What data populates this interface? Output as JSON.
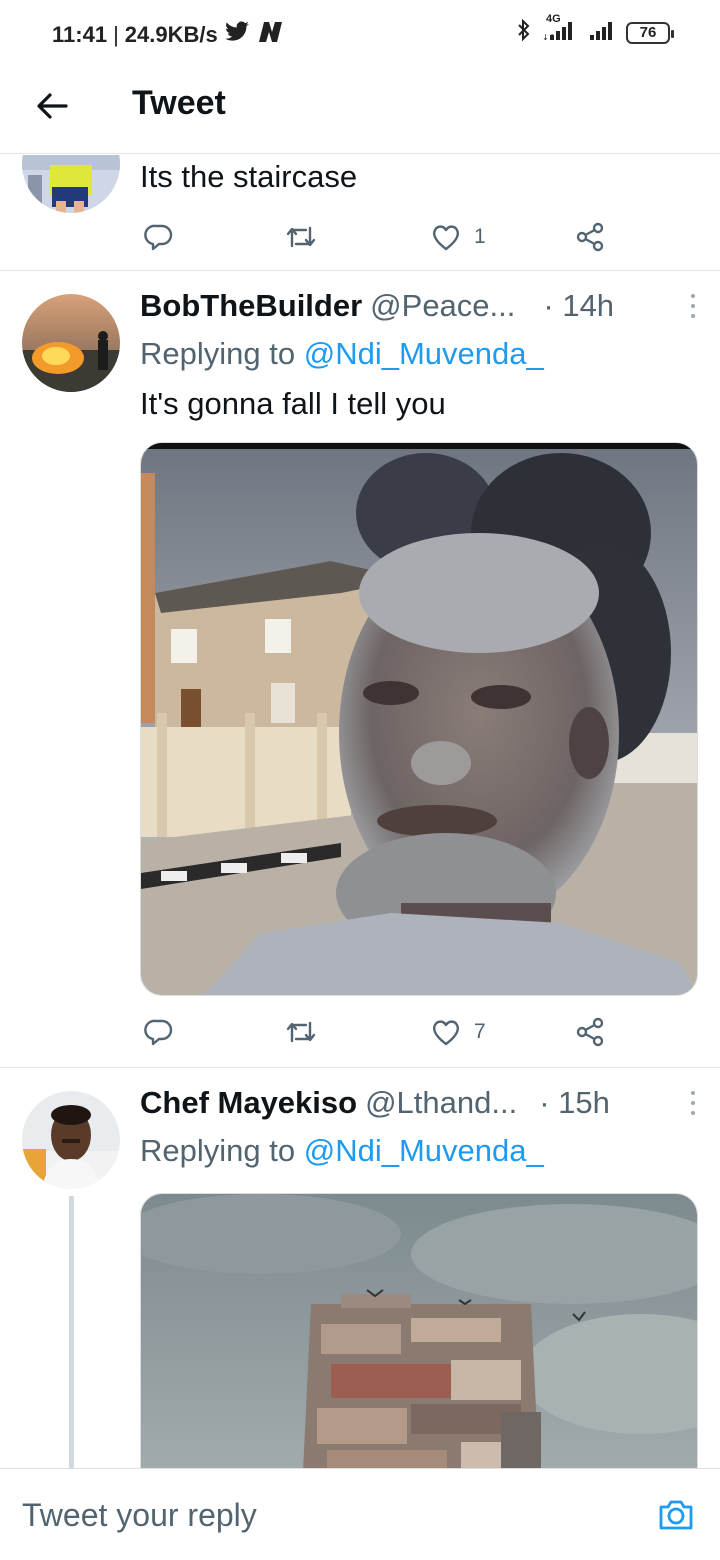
{
  "status_bar": {
    "time": "11:41",
    "speed": "24.9KB/s",
    "network": "4G",
    "battery": "76",
    "icons": [
      "twitter-bird-icon",
      "netflix-icon",
      "bluetooth-icon",
      "signal-icon",
      "battery-icon"
    ]
  },
  "header": {
    "title": "Tweet",
    "back_icon": "back-arrow-icon"
  },
  "tweets": [
    {
      "text": "Its the staircase",
      "likes": "1"
    },
    {
      "display_name": "BobTheBuilder",
      "handle": "@Peace...",
      "time": "· 14h",
      "replying_prefix": "Replying to",
      "replying_to": "@Ndi_Muvenda_",
      "text": "It's gonna fall I tell you",
      "likes": "7"
    },
    {
      "display_name": "Chef Mayekiso",
      "handle": "@Lthand...",
      "time": "· 15h",
      "replying_prefix": "Replying to",
      "replying_to": "@Ndi_Muvenda_"
    }
  ],
  "reply_bar": {
    "placeholder": "Tweet your reply",
    "camera_icon": "camera-icon"
  },
  "colors": {
    "accent": "#1d9bf0",
    "muted": "#536471",
    "text": "#0f1419"
  }
}
